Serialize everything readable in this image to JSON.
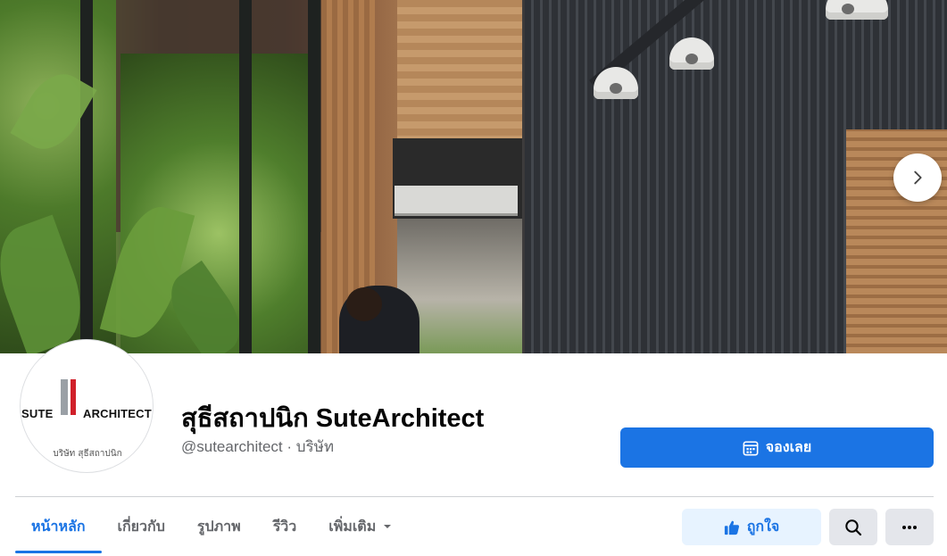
{
  "page": {
    "name": "สุธีสถาปนิก SuteArchitect",
    "handle_category": "@sutearchitect · บริษัท"
  },
  "avatar": {
    "logo_left": "SUTE",
    "logo_right": "ARCHITECT",
    "logo_subtext": "บริษัท สุธีสถาปนิก"
  },
  "actions": {
    "book_label": "จองเลย",
    "like_label": "ถูกใจ"
  },
  "tabs": [
    {
      "label": "หน้าหลัก",
      "active": true
    },
    {
      "label": "เกี่ยวกับ",
      "active": false
    },
    {
      "label": "รูปภาพ",
      "active": false
    },
    {
      "label": "รีวิว",
      "active": false
    },
    {
      "label": "เพิ่มเติม",
      "active": false
    }
  ],
  "icons": {
    "cover_next": "chevron-right-icon",
    "book": "calendar-icon",
    "like": "thumbs-up-icon",
    "more_tab": "caret-down-icon",
    "search": "search-icon",
    "menu": "more-horizontal-icon"
  },
  "colors": {
    "accent": "#1b74e4",
    "accent_light": "#e7f3ff",
    "button_gray": "#e4e6eb",
    "text_secondary": "#65676b",
    "logo_red": "#d0202a"
  }
}
